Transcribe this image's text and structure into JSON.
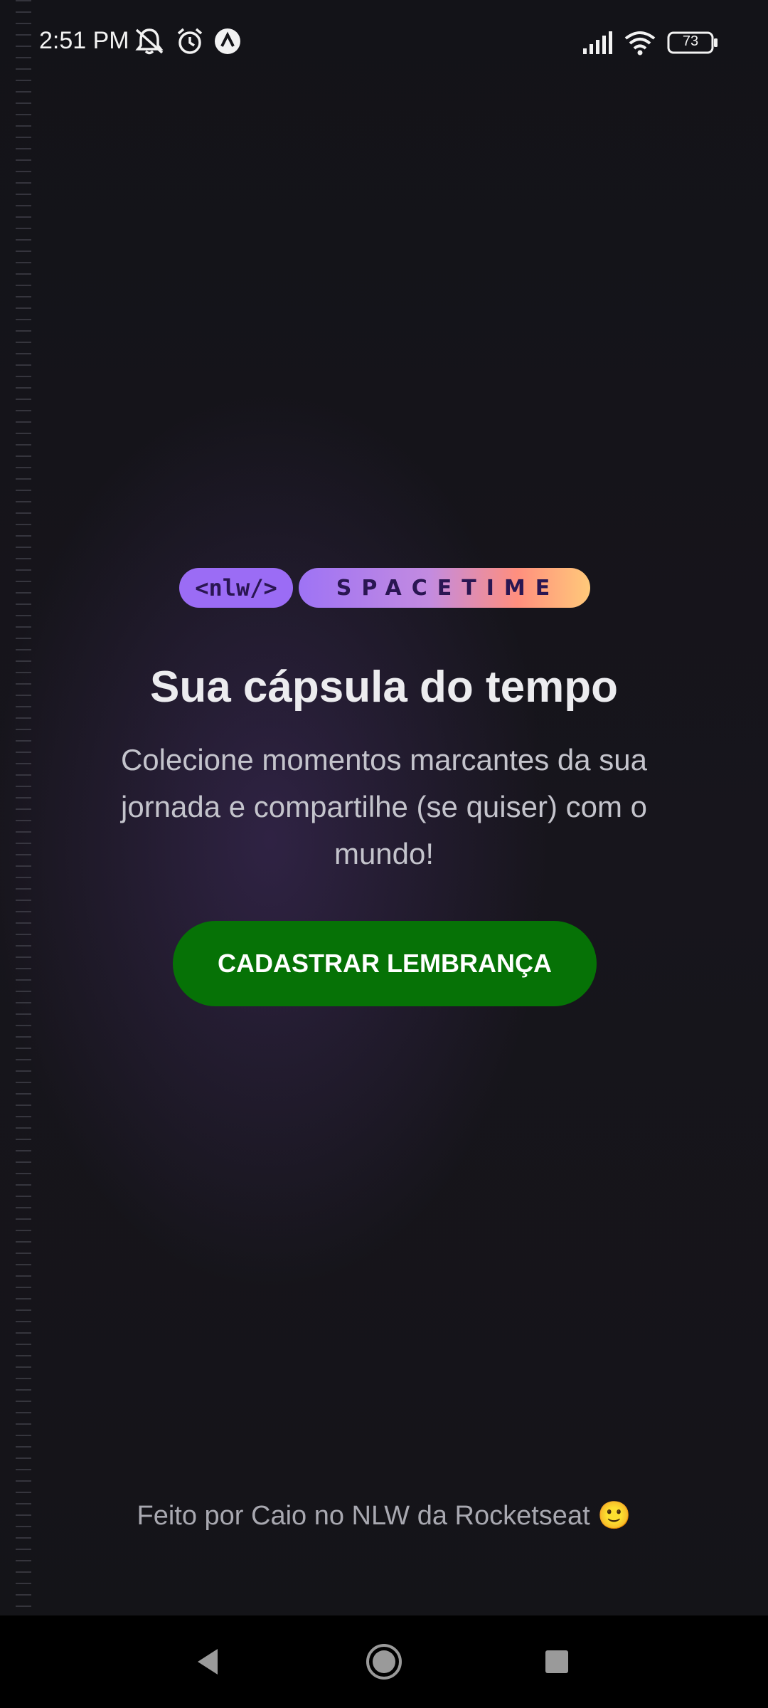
{
  "status_bar": {
    "time": "2:51 PM",
    "battery": "73",
    "icons_left": [
      "muted-bell-icon",
      "alarm-icon",
      "app-notification-icon"
    ],
    "icons_right": [
      "signal-icon",
      "wifi-icon",
      "battery-icon"
    ]
  },
  "logo": {
    "nlw": "<nlw/>",
    "spacetime": "SPACETIME"
  },
  "main": {
    "title": "Sua cápsula do tempo",
    "description": "Colecione momentos marcantes da sua jornada e compartilhe (se quiser) com o mundo!",
    "cta_label": "CADASTRAR LEMBRANÇA"
  },
  "footer": {
    "text": "Feito por Caio no NLW da Rocketseat 🙂"
  },
  "nav": {
    "buttons": [
      "back-icon",
      "home-icon",
      "recents-icon"
    ]
  },
  "colors": {
    "cta": "#067206",
    "logo_purple": "#9b6cf5",
    "logo_orange": "#ffc97a",
    "background": "#121215"
  }
}
